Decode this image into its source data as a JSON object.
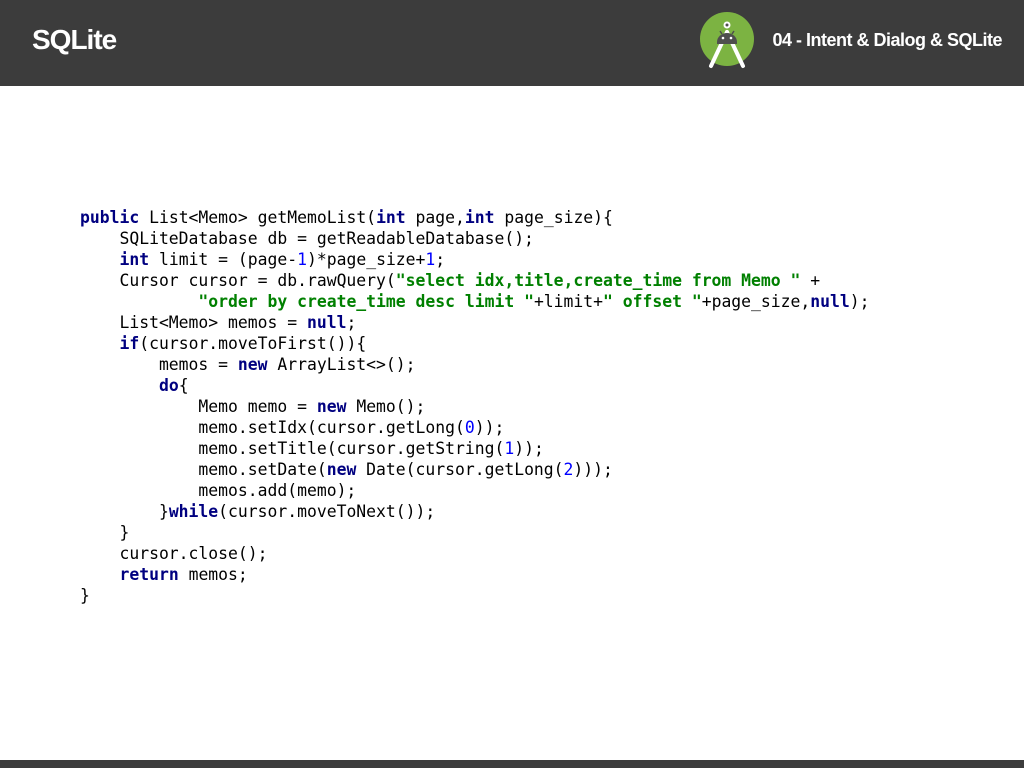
{
  "header": {
    "title": "SQLite",
    "section": "04 - Intent & Dialog & SQLite",
    "logo_icon": "android-studio-icon",
    "bar_color": "#3c3c3c"
  },
  "code": {
    "lines": [
      [
        [
          "kw",
          "public"
        ],
        [
          "p",
          " List<Memo> getMemoList("
        ],
        [
          "kw",
          "int"
        ],
        [
          "p",
          " page,"
        ],
        [
          "kw",
          "int"
        ],
        [
          "p",
          " page_size){"
        ]
      ],
      [
        [
          "p",
          "    SQLiteDatabase db = getReadableDatabase();"
        ]
      ],
      [
        [
          "p",
          "    "
        ],
        [
          "kw",
          "int"
        ],
        [
          "p",
          " limit = (page-"
        ],
        [
          "num",
          "1"
        ],
        [
          "p",
          ")*page_size+"
        ],
        [
          "num",
          "1"
        ],
        [
          "p",
          ";"
        ]
      ],
      [
        [
          "p",
          "    Cursor cursor = db.rawQuery("
        ],
        [
          "str",
          "\"select idx,title,create_time from Memo \""
        ],
        [
          "p",
          " +"
        ]
      ],
      [
        [
          "p",
          "            "
        ],
        [
          "str",
          "\"order by create_time desc limit \""
        ],
        [
          "p",
          "+limit+"
        ],
        [
          "str",
          "\" offset \""
        ],
        [
          "p",
          "+page_size,"
        ],
        [
          "kw",
          "null"
        ],
        [
          "p",
          ");"
        ]
      ],
      [
        [
          "p",
          "    List<Memo> memos = "
        ],
        [
          "kw",
          "null"
        ],
        [
          "p",
          ";"
        ]
      ],
      [
        [
          "p",
          "    "
        ],
        [
          "kw",
          "if"
        ],
        [
          "p",
          "(cursor.moveToFirst()){"
        ]
      ],
      [
        [
          "p",
          "        memos = "
        ],
        [
          "kw",
          "new"
        ],
        [
          "p",
          " ArrayList<>();"
        ]
      ],
      [
        [
          "p",
          "        "
        ],
        [
          "kw",
          "do"
        ],
        [
          "p",
          "{"
        ]
      ],
      [
        [
          "p",
          "            Memo memo = "
        ],
        [
          "kw",
          "new"
        ],
        [
          "p",
          " Memo();"
        ]
      ],
      [
        [
          "p",
          "            memo.setIdx(cursor.getLong("
        ],
        [
          "num",
          "0"
        ],
        [
          "p",
          "));"
        ]
      ],
      [
        [
          "p",
          "            memo.setTitle(cursor.getString("
        ],
        [
          "num",
          "1"
        ],
        [
          "p",
          "));"
        ]
      ],
      [
        [
          "p",
          "            memo.setDate("
        ],
        [
          "kw",
          "new"
        ],
        [
          "p",
          " Date(cursor.getLong("
        ],
        [
          "num",
          "2"
        ],
        [
          "p",
          ")));"
        ]
      ],
      [
        [
          "p",
          "            memos.add(memo);"
        ]
      ],
      [
        [
          "p",
          "        }"
        ],
        [
          "kw",
          "while"
        ],
        [
          "p",
          "(cursor.moveToNext());"
        ]
      ],
      [
        [
          "p",
          "    }"
        ]
      ],
      [
        [
          "p",
          "    cursor.close();"
        ]
      ],
      [
        [
          "p",
          "    "
        ],
        [
          "kw",
          "return"
        ],
        [
          "p",
          " memos;"
        ]
      ],
      [
        [
          "p",
          "}"
        ]
      ]
    ]
  }
}
